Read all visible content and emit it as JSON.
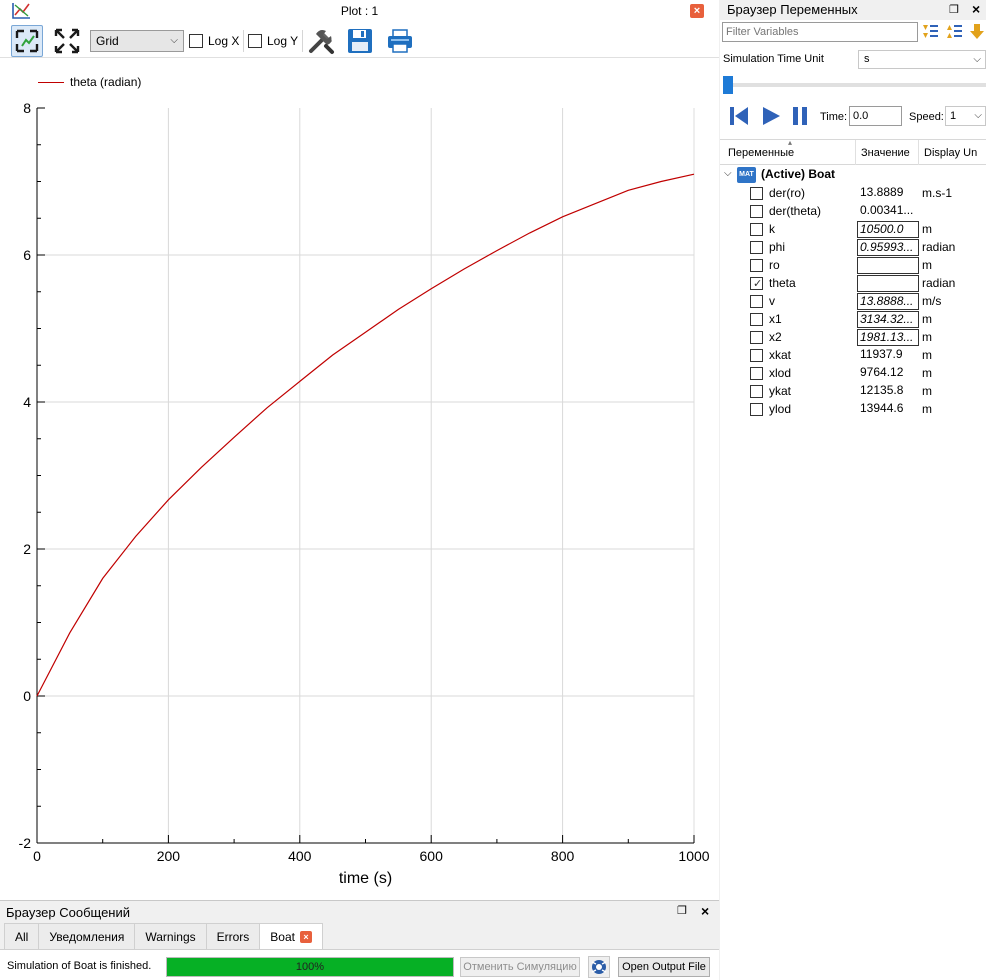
{
  "plot_window": {
    "title": "Plot : 1",
    "grid_option": "Grid",
    "log_x_label": "Log X",
    "log_y_label": "Log Y",
    "log_x_checked": false,
    "log_y_checked": false
  },
  "chart_data": {
    "type": "line",
    "title": "",
    "xlabel": "time (s)",
    "ylabel": "",
    "xlim": [
      0,
      1000
    ],
    "ylim": [
      -2,
      8
    ],
    "x_ticks": [
      0,
      200,
      400,
      600,
      800,
      1000
    ],
    "y_ticks": [
      -2,
      0,
      2,
      4,
      6,
      8
    ],
    "grid": true,
    "legend_position": "top-left",
    "series": [
      {
        "name": "theta (radian)",
        "color": "#c00000",
        "x": [
          0,
          50,
          100,
          150,
          200,
          250,
          300,
          350,
          400,
          450,
          500,
          550,
          600,
          650,
          700,
          750,
          800,
          850,
          900,
          950,
          1000
        ],
        "y": [
          0,
          0.86,
          1.6,
          2.17,
          2.67,
          3.11,
          3.52,
          3.92,
          4.28,
          4.64,
          4.95,
          5.26,
          5.54,
          5.81,
          6.06,
          6.3,
          6.52,
          6.7,
          6.88,
          7.0,
          7.1
        ]
      }
    ]
  },
  "message_browser": {
    "title": "Браузер Сообщений",
    "tabs": [
      "All",
      "Уведомления",
      "Warnings",
      "Errors",
      "Boat"
    ],
    "active_tab": "Boat",
    "status_text": "Simulation of Boat is finished.",
    "progress_percent": 100,
    "progress_label": "100%",
    "cancel_button": "Отменить Симуляцию",
    "open_output_button": "Open Output File"
  },
  "variables_browser": {
    "title": "Браузер Переменных",
    "filter_placeholder": "Filter Variables",
    "sim_time_unit_label": "Simulation Time Unit",
    "sim_time_unit_value": "s",
    "time_label": "Time:",
    "time_value": "0.0",
    "speed_label": "Speed:",
    "speed_value": "1",
    "columns": [
      "Переменные",
      "Значение",
      "Display Un"
    ],
    "root_label": "(Active) Boat",
    "root_icon_text": "MAT",
    "variables": [
      {
        "name": "der(ro)",
        "value": "13.8889",
        "unit": "m.s-1",
        "checked": false,
        "editable": false
      },
      {
        "name": "der(theta)",
        "value": "0.00341...",
        "unit": "",
        "checked": false,
        "editable": false
      },
      {
        "name": "k",
        "value": "10500.0",
        "unit": "m",
        "checked": false,
        "editable": true
      },
      {
        "name": "phi",
        "value": "0.95993...",
        "unit": "radian",
        "checked": false,
        "editable": true
      },
      {
        "name": "ro",
        "value": "",
        "unit": "m",
        "checked": false,
        "editable": true
      },
      {
        "name": "theta",
        "value": "",
        "unit": "radian",
        "checked": true,
        "editable": true
      },
      {
        "name": "v",
        "value": "13.8888...",
        "unit": "m/s",
        "checked": false,
        "editable": true
      },
      {
        "name": "x1",
        "value": "3134.32...",
        "unit": "m",
        "checked": false,
        "editable": true
      },
      {
        "name": "x2",
        "value": "1981.13...",
        "unit": "m",
        "checked": false,
        "editable": true
      },
      {
        "name": "xkat",
        "value": "11937.9",
        "unit": "m",
        "checked": false,
        "editable": false
      },
      {
        "name": "xlod",
        "value": "9764.12",
        "unit": "m",
        "checked": false,
        "editable": false
      },
      {
        "name": "ykat",
        "value": "12135.8",
        "unit": "m",
        "checked": false,
        "editable": false
      },
      {
        "name": "ylod",
        "value": "13944.6",
        "unit": "m",
        "checked": false,
        "editable": false
      }
    ]
  }
}
